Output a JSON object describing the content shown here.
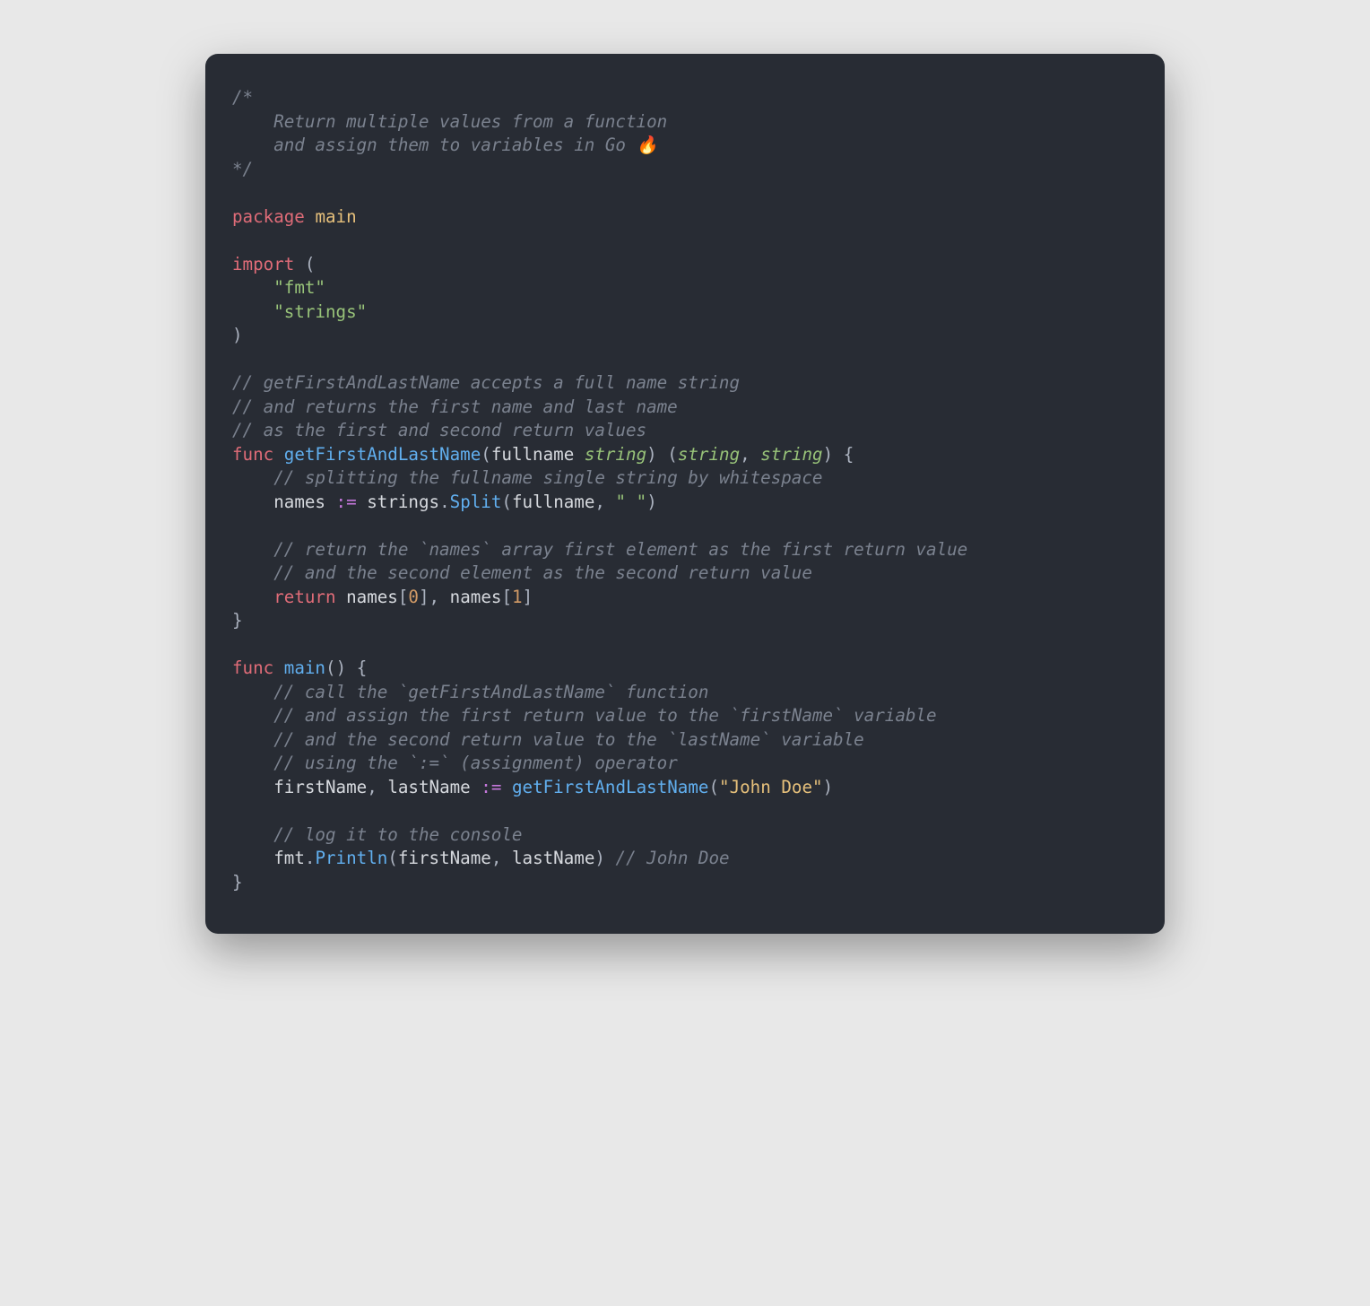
{
  "code": {
    "c1a": "/*",
    "c1b": "    Return multiple values from a function",
    "c1c": "    and assign them to variables in Go 🔥",
    "c1d": "*/",
    "kw_package": "package",
    "pkg_main": "main",
    "kw_import": "import",
    "p_open": "(",
    "p_close": ")",
    "imp_fmt": "\"fmt\"",
    "imp_strings": "\"strings\"",
    "c2a": "// getFirstAndLastName accepts a full name string",
    "c2b": "// and returns the first name and last name",
    "c2c": "// as the first and second return values",
    "kw_func": "func",
    "fn_getFL": "getFirstAndLastName",
    "param_fullname": "fullname",
    "type_string": "string",
    "brace_open": "{",
    "brace_close": "}",
    "c3": "// splitting the fullname single string by whitespace",
    "id_names": "names",
    "op_decl": ":=",
    "id_strings": "strings",
    "dot": ".",
    "call_split": "Split",
    "comma": ",",
    "str_space": "\" \"",
    "c4a": "// return the `names` array first element as the first return value",
    "c4b": "// and the second element as the second return value",
    "kw_return": "return",
    "br_open": "[",
    "br_close": "]",
    "num0": "0",
    "num1": "1",
    "fn_main": "main",
    "paren_open": "(",
    "paren_close": ")",
    "c5a": "// call the `getFirstAndLastName` function",
    "c5b": "// and assign the first return value to the `firstName` variable",
    "c5c": "// and the second return value to the `lastName` variable",
    "c5d": "// using the `:=` (assignment) operator",
    "id_firstName": "firstName",
    "id_lastName": "lastName",
    "str_johndoe": "\"John Doe\"",
    "c6": "// log it to the console",
    "id_fmt": "fmt",
    "call_println": "Println",
    "c7": "// John Doe"
  }
}
